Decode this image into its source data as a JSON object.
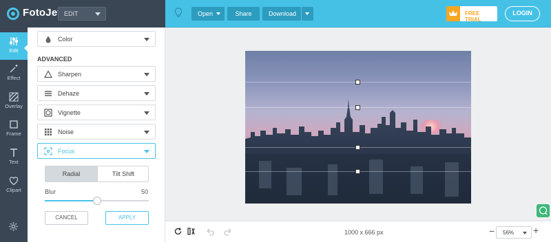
{
  "app": {
    "brand": "FotoJet",
    "mode": "EDIT"
  },
  "toolbar": {
    "open_label": "Open",
    "share_label": "Share",
    "download_label": "Download",
    "trial_label": "FREE TRIAL",
    "login_label": "LOGIN",
    "icons": [
      "lightbulb-icon",
      "crown-icon"
    ]
  },
  "leftnav": {
    "items": [
      {
        "label": "Edit",
        "icon": "sliders-icon",
        "active": true
      },
      {
        "label": "Effect",
        "icon": "magic-wand-icon",
        "active": false
      },
      {
        "label": "Overlay",
        "icon": "stripes-icon",
        "active": false
      },
      {
        "label": "Frame",
        "icon": "frame-icon",
        "active": false
      },
      {
        "label": "Text",
        "icon": "text-icon",
        "active": false
      },
      {
        "label": "Clipart",
        "icon": "heart-icon",
        "active": false
      }
    ],
    "settings_icon": "gear-icon"
  },
  "panel": {
    "color_label": "Color",
    "advanced_heading": "ADVANCED",
    "tools": [
      {
        "label": "Sharpen",
        "icon": "triangle-icon"
      },
      {
        "label": "Dehaze",
        "icon": "lines-icon"
      },
      {
        "label": "Vignette",
        "icon": "vignette-icon"
      },
      {
        "label": "Noise",
        "icon": "grid-dots-icon"
      },
      {
        "label": "Focus",
        "icon": "focus-icon",
        "active": true
      }
    ],
    "focus": {
      "modes": [
        "Radial",
        "Tilt Shift"
      ],
      "selected_mode": "Radial",
      "blur_label": "Blur",
      "blur_value": "50",
      "blur_fraction": 0.5,
      "cancel_label": "CANCEL",
      "apply_label": "APPLY"
    }
  },
  "canvas": {
    "dimensions": "1000 x 666 px"
  },
  "bottombar": {
    "zoom": "56%",
    "minus": "−",
    "plus": "+"
  },
  "colors": {
    "accent": "#48c3e8",
    "dark": "#3a4654",
    "trial": "#f5a623",
    "chat": "#3cb878"
  }
}
